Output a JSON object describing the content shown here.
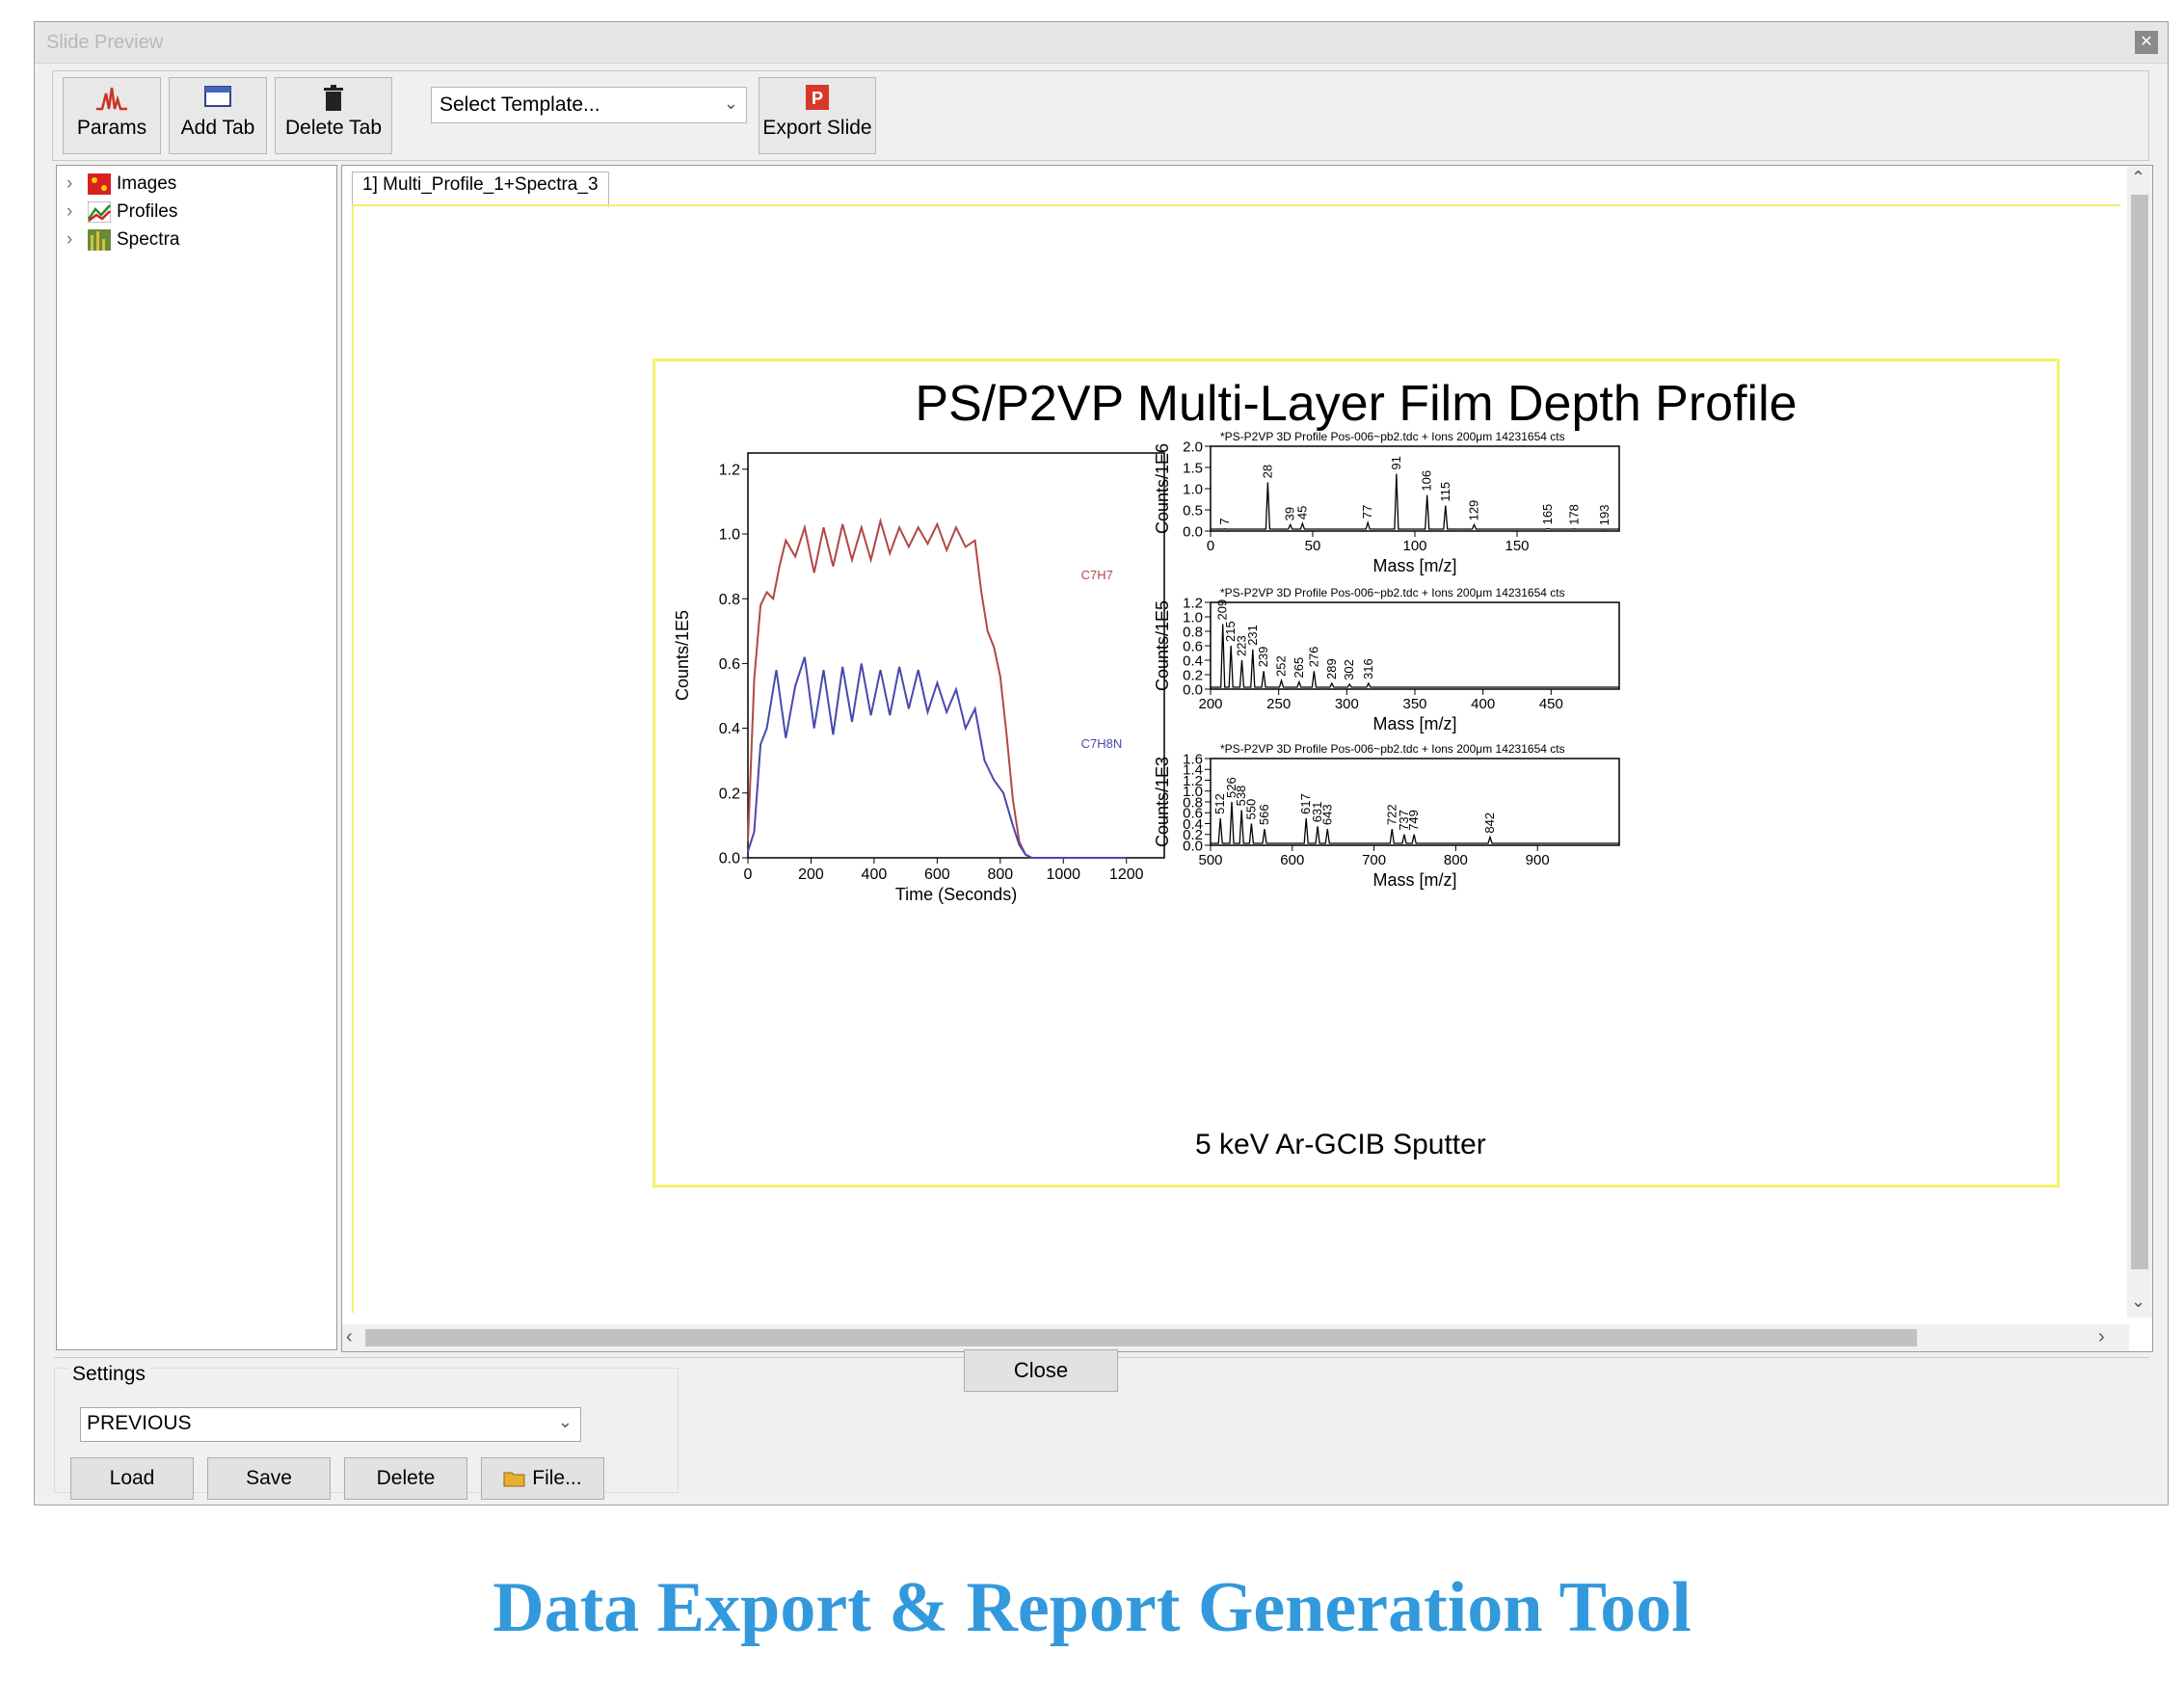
{
  "window": {
    "title": "Slide Preview",
    "close_glyph": "✕"
  },
  "toolbar": {
    "params_label": "Params",
    "add_tab_label": "Add Tab",
    "delete_tab_label": "Delete Tab",
    "template_select_value": "Select Template...",
    "export_slide_label": "Export Slide"
  },
  "tree": {
    "items": [
      {
        "label": "Images",
        "icon": "images-icon"
      },
      {
        "label": "Profiles",
        "icon": "profiles-icon"
      },
      {
        "label": "Spectra",
        "icon": "spectra-icon"
      }
    ]
  },
  "tabs": [
    {
      "label": "1] Multi_Profile_1+Spectra_3"
    }
  ],
  "slide": {
    "title": "PS/P2VP Multi-Layer Film Depth Profile",
    "subtitle": "5 keV Ar-GCIB Sputter"
  },
  "settings": {
    "legend": "Settings",
    "selected": "PREVIOUS",
    "load_label": "Load",
    "save_label": "Save",
    "delete_label": "Delete",
    "file_label": "File..."
  },
  "close_label": "Close",
  "caption": "Data Export & Report Generation Tool",
  "colors": {
    "series_red": "#b04848",
    "series_blue": "#4848b0",
    "caption": "#3399dd"
  },
  "chart_data": [
    {
      "type": "line",
      "title": "",
      "xlabel": "Time (Seconds)",
      "ylabel": "Counts/1E5",
      "xlim": [
        0,
        1320
      ],
      "ylim": [
        0,
        1.25
      ],
      "xticks": [
        0,
        200,
        400,
        600,
        800,
        1000,
        1200
      ],
      "yticks": [
        0.0,
        0.2,
        0.4,
        0.6,
        0.8,
        1.0,
        1.2
      ],
      "series": [
        {
          "name": "C7H7",
          "color": "#b04848",
          "x": [
            0,
            20,
            40,
            60,
            80,
            100,
            120,
            150,
            180,
            210,
            240,
            270,
            300,
            330,
            360,
            390,
            420,
            450,
            480,
            510,
            540,
            570,
            600,
            630,
            660,
            690,
            720,
            740,
            760,
            780,
            800,
            820,
            840,
            860,
            880,
            900,
            1000,
            1100,
            1200
          ],
          "y": [
            0.05,
            0.55,
            0.78,
            0.82,
            0.8,
            0.9,
            0.98,
            0.93,
            1.02,
            0.88,
            1.02,
            0.9,
            1.03,
            0.92,
            1.02,
            0.92,
            1.04,
            0.94,
            1.02,
            0.96,
            1.02,
            0.97,
            1.03,
            0.95,
            1.02,
            0.96,
            0.98,
            0.82,
            0.7,
            0.65,
            0.56,
            0.38,
            0.18,
            0.05,
            0.01,
            0.0,
            0.0,
            0.0,
            0.0
          ]
        },
        {
          "name": "C7H8N",
          "color": "#4848b0",
          "x": [
            0,
            20,
            40,
            60,
            90,
            120,
            150,
            180,
            210,
            240,
            270,
            300,
            330,
            360,
            390,
            420,
            450,
            480,
            510,
            540,
            570,
            600,
            630,
            660,
            690,
            720,
            750,
            780,
            810,
            840,
            860,
            880,
            900,
            1000,
            1100,
            1200
          ],
          "y": [
            0.02,
            0.08,
            0.35,
            0.4,
            0.58,
            0.37,
            0.53,
            0.62,
            0.4,
            0.58,
            0.38,
            0.59,
            0.42,
            0.6,
            0.44,
            0.58,
            0.44,
            0.59,
            0.46,
            0.58,
            0.45,
            0.54,
            0.45,
            0.52,
            0.4,
            0.46,
            0.3,
            0.24,
            0.2,
            0.1,
            0.04,
            0.01,
            0.0,
            0.0,
            0.0,
            0.0
          ]
        }
      ]
    },
    {
      "type": "line",
      "title": "*PS-P2VP 3D Profile Pos-006~pb2.tdc + Ions 200μm 14231654 cts",
      "xlabel": "Mass [m/z]",
      "ylabel": "Counts/1E6",
      "xlim": [
        0,
        200
      ],
      "ylim": [
        0,
        2.0
      ],
      "xticks": [
        0,
        50,
        100,
        150
      ],
      "yticks": [
        0.0,
        0.5,
        1.0,
        1.5,
        2.0
      ],
      "peaks": [
        {
          "x": 7,
          "y": 0.05
        },
        {
          "x": 28,
          "y": 1.15
        },
        {
          "x": 39,
          "y": 0.15
        },
        {
          "x": 45,
          "y": 0.18
        },
        {
          "x": 77,
          "y": 0.2
        },
        {
          "x": 91,
          "y": 1.35
        },
        {
          "x": 106,
          "y": 0.85
        },
        {
          "x": 115,
          "y": 0.6
        },
        {
          "x": 129,
          "y": 0.15
        },
        {
          "x": 165,
          "y": 0.06
        },
        {
          "x": 178,
          "y": 0.05
        },
        {
          "x": 193,
          "y": 0.04
        }
      ]
    },
    {
      "type": "line",
      "title": "*PS-P2VP 3D Profile Pos-006~pb2.tdc + Ions 200μm 14231654 cts",
      "xlabel": "Mass [m/z]",
      "ylabel": "Counts/1E5",
      "xlim": [
        200,
        500
      ],
      "ylim": [
        0,
        1.2
      ],
      "xticks": [
        200,
        250,
        300,
        350,
        400,
        450
      ],
      "yticks": [
        0.0,
        0.2,
        0.4,
        0.6,
        0.8,
        1.0,
        1.2
      ],
      "peaks": [
        {
          "x": 209,
          "y": 0.9
        },
        {
          "x": 215,
          "y": 0.6
        },
        {
          "x": 223,
          "y": 0.4
        },
        {
          "x": 231,
          "y": 0.55
        },
        {
          "x": 239,
          "y": 0.25
        },
        {
          "x": 252,
          "y": 0.12
        },
        {
          "x": 265,
          "y": 0.1
        },
        {
          "x": 276,
          "y": 0.25
        },
        {
          "x": 289,
          "y": 0.08
        },
        {
          "x": 302,
          "y": 0.07
        },
        {
          "x": 316,
          "y": 0.08
        }
      ]
    },
    {
      "type": "line",
      "title": "*PS-P2VP 3D Profile Pos-006~pb2.tdc + Ions 200μm 14231654 cts",
      "xlabel": "Mass [m/z]",
      "ylabel": "Counts/1E3",
      "xlim": [
        500,
        1000
      ],
      "ylim": [
        0,
        1.6
      ],
      "xticks": [
        500,
        600,
        700,
        800,
        900
      ],
      "yticks": [
        0.0,
        0.2,
        0.4,
        0.6,
        0.8,
        1.0,
        1.2,
        1.4,
        1.6
      ],
      "peaks": [
        {
          "x": 512,
          "y": 0.5
        },
        {
          "x": 526,
          "y": 0.8
        },
        {
          "x": 538,
          "y": 0.65
        },
        {
          "x": 550,
          "y": 0.4
        },
        {
          "x": 566,
          "y": 0.3
        },
        {
          "x": 617,
          "y": 0.5
        },
        {
          "x": 631,
          "y": 0.35
        },
        {
          "x": 643,
          "y": 0.3
        },
        {
          "x": 722,
          "y": 0.3
        },
        {
          "x": 737,
          "y": 0.2
        },
        {
          "x": 749,
          "y": 0.2
        },
        {
          "x": 842,
          "y": 0.15
        }
      ]
    }
  ]
}
